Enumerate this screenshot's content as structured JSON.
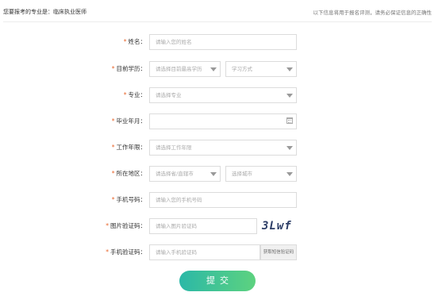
{
  "header": {
    "major_text": "您要报考的专业是：临床执业医师",
    "notice_text": "以下信息将用于报名评测，请务必保证信息的正确性"
  },
  "required_mark": "*",
  "fields": {
    "name": {
      "label": "姓名：",
      "placeholder": "请输入您的姓名"
    },
    "education": {
      "label": "目前学历：",
      "placeholder": "请选择目前最高学历",
      "study_mode_placeholder": "学习方式"
    },
    "major": {
      "label": "专业：",
      "placeholder": "请选择专业"
    },
    "graduation": {
      "label": "毕业年月：",
      "placeholder": ""
    },
    "work_years": {
      "label": "工作年限：",
      "placeholder": "请选择工作年限"
    },
    "region": {
      "label": "所在地区：",
      "province_placeholder": "请选择省/直辖市",
      "city_placeholder": "选择城市"
    },
    "phone": {
      "label": "手机号码：",
      "placeholder": "请输入您的手机号码"
    },
    "image_code": {
      "label": "图片验证码：",
      "placeholder": "请输入图片验证码",
      "captcha_text": "3Lwf"
    },
    "sms_code": {
      "label": "手机验证码：",
      "placeholder": "请输入手机验证码",
      "get_code_label": "获取短信验证码"
    }
  },
  "submit_label": "提交",
  "icons": {
    "dropdown": "chevron-down-icon",
    "calendar": "calendar-icon"
  },
  "colors": {
    "required": "#e8662c",
    "submit_start": "#2bb8a7",
    "submit_end": "#5dd27f"
  }
}
